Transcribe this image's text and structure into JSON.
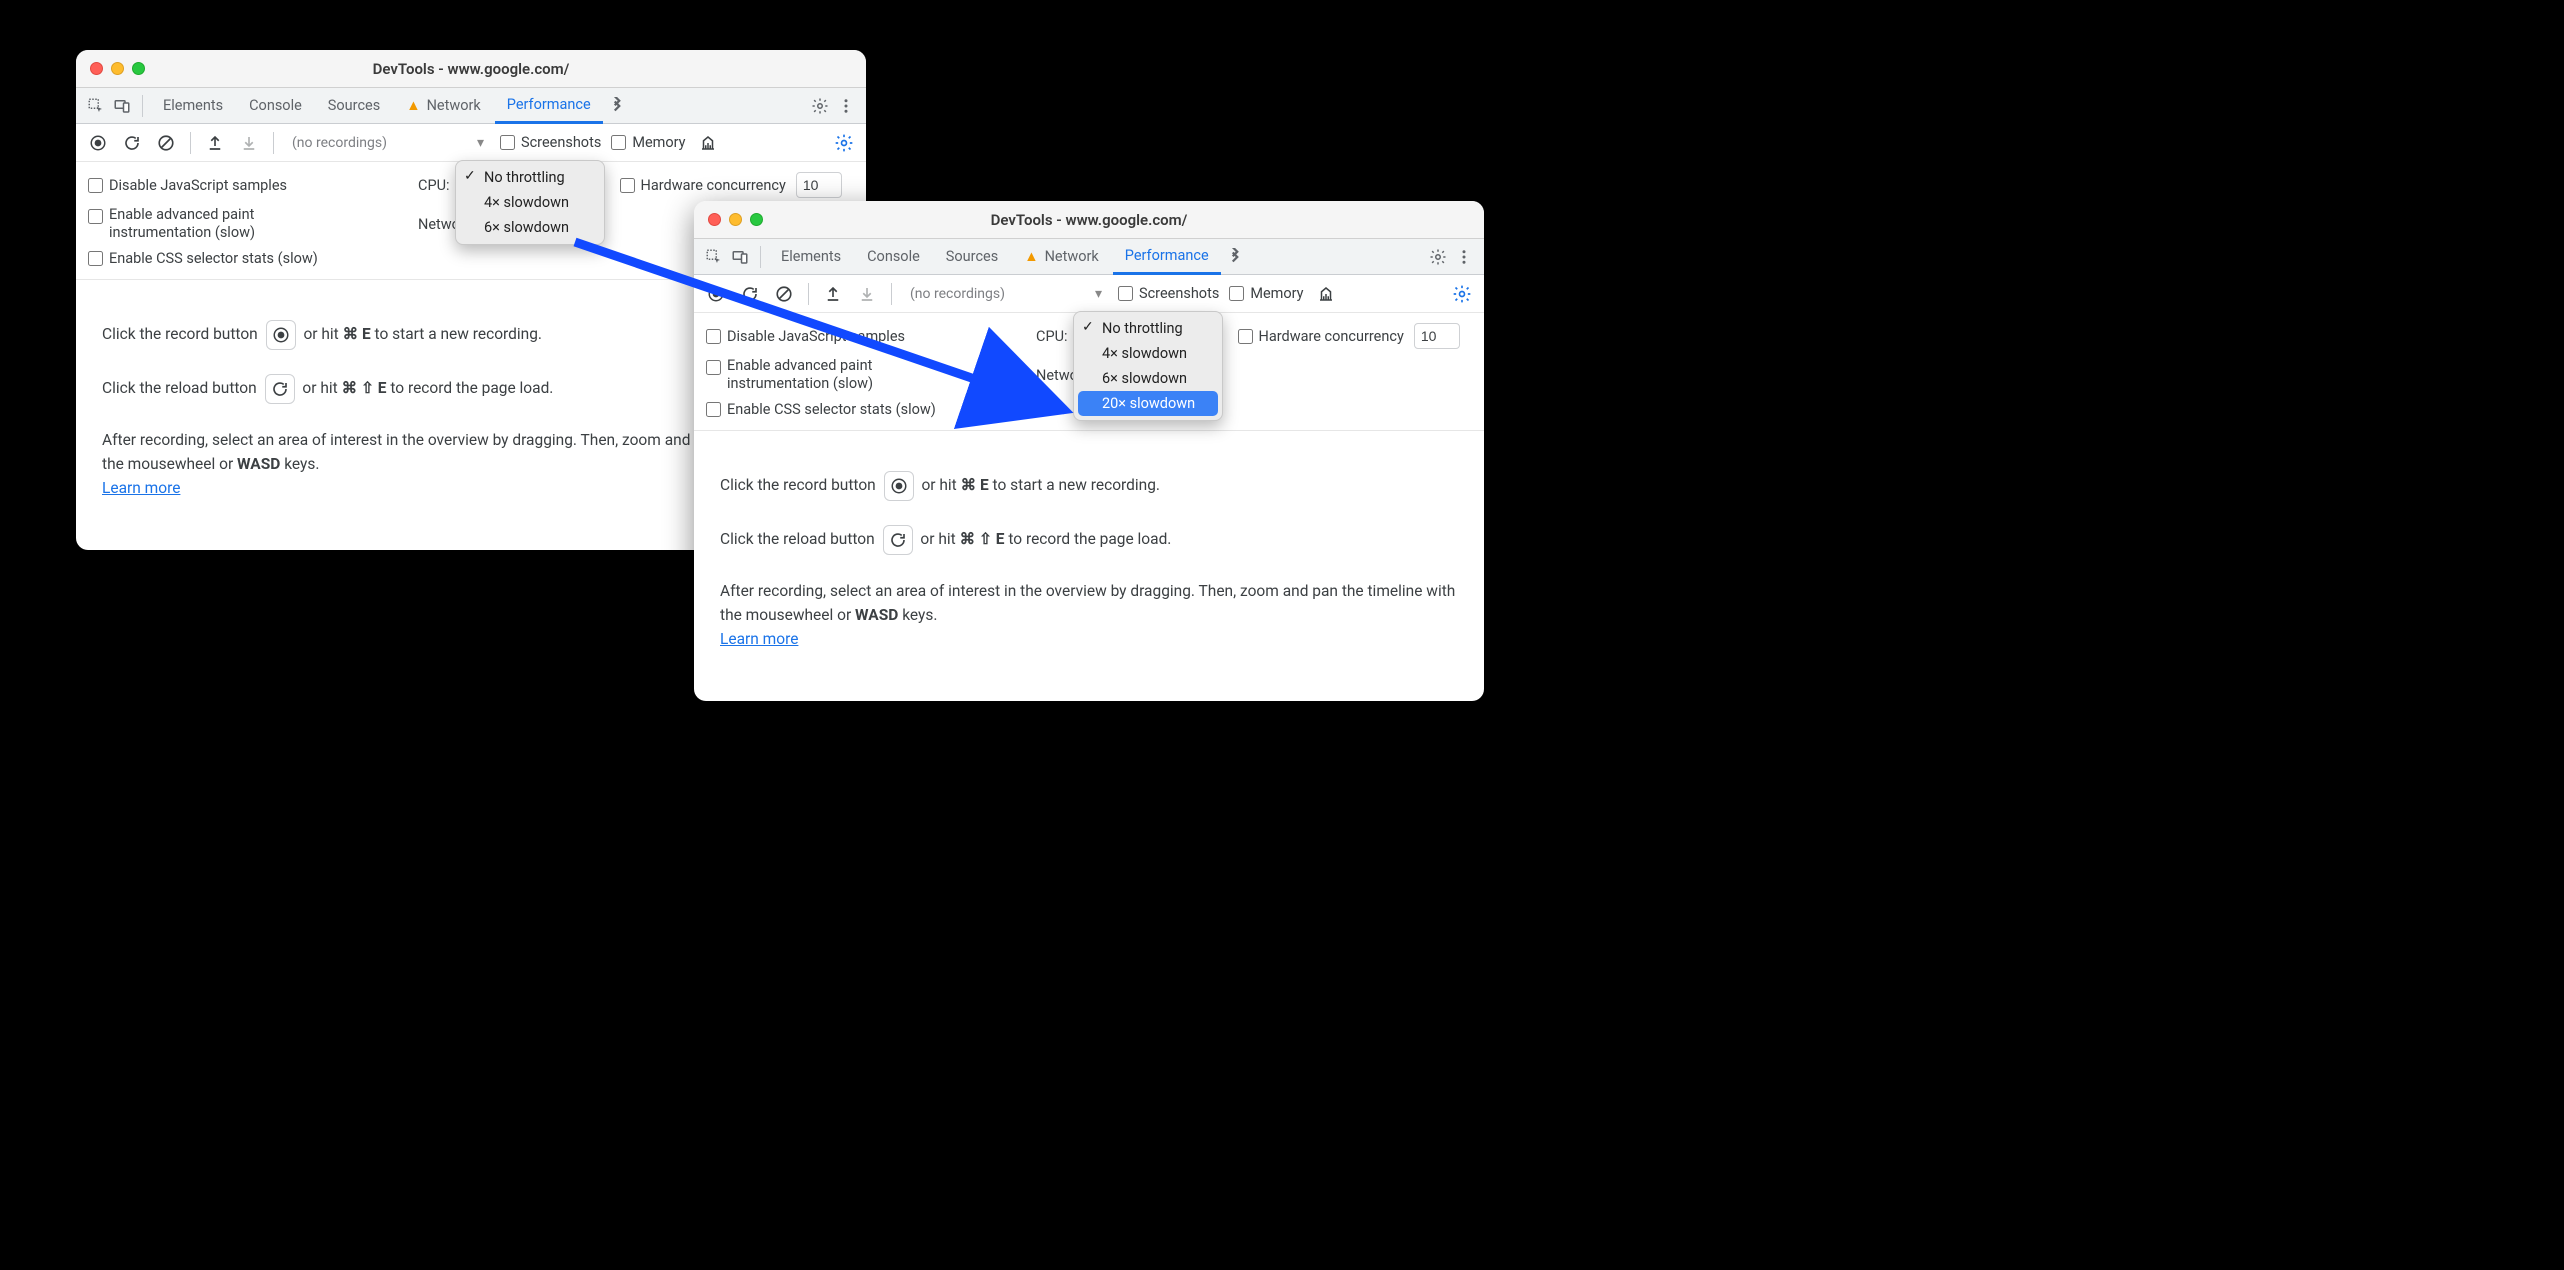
{
  "windows": {
    "left": {
      "title": "DevTools - www.google.com/",
      "tabs": [
        "Elements",
        "Console",
        "Sources",
        "Network",
        "Performance"
      ],
      "active_tab": "Performance",
      "recordings_placeholder": "(no recordings)",
      "screenshots_label": "Screenshots",
      "memory_label": "Memory",
      "settings": {
        "disable_js": "Disable JavaScript samples",
        "adv_paint": "Enable advanced paint instrumentation (slow)",
        "css_stats": "Enable CSS selector stats (slow)",
        "cpu_label": "CPU:",
        "network_label": "Network:",
        "hw_label": "Hardware concurrency",
        "hw_value": "10"
      },
      "cpu_dropdown": {
        "options": [
          "No throttling",
          "4× slowdown",
          "6× slowdown"
        ],
        "selected": "No throttling"
      },
      "hints": {
        "record": [
          "Click the record button ",
          "or hit ",
          "⌘ E",
          " to start a new recording."
        ],
        "reload": [
          "Click the reload button ",
          "or hit ",
          "⌘ ⇧ E",
          " to record the page load."
        ],
        "after": [
          "After recording, select an area of interest in the overview by dragging. Then, zoom and pan the timeline with the mousewheel or ",
          "WASD",
          " keys."
        ],
        "learn": "Learn more"
      }
    },
    "right": {
      "title": "DevTools - www.google.com/",
      "tabs": [
        "Elements",
        "Console",
        "Sources",
        "Network",
        "Performance"
      ],
      "active_tab": "Performance",
      "recordings_placeholder": "(no recordings)",
      "screenshots_label": "Screenshots",
      "memory_label": "Memory",
      "settings": {
        "disable_js": "Disable JavaScript samples",
        "adv_paint": "Enable advanced paint instrumentation (slow)",
        "css_stats": "Enable CSS selector stats (slow)",
        "cpu_label": "CPU:",
        "network_label": "Network:",
        "hw_label": "Hardware concurrency",
        "hw_value": "10"
      },
      "cpu_dropdown": {
        "options": [
          "No throttling",
          "4× slowdown",
          "6× slowdown",
          "20× slowdown"
        ],
        "selected": "No throttling",
        "highlighted": "20× slowdown"
      },
      "hints": {
        "record": [
          "Click the record button ",
          "or hit ",
          "⌘ E",
          " to start a new recording."
        ],
        "reload": [
          "Click the reload button ",
          "or hit ",
          "⌘ ⇧ E",
          " to record the page load."
        ],
        "after": [
          "After recording, select an area of interest in the overview by dragging. Then, zoom and pan the timeline with the mousewheel or ",
          "WASD",
          " keys."
        ],
        "learn": "Learn more"
      }
    }
  }
}
